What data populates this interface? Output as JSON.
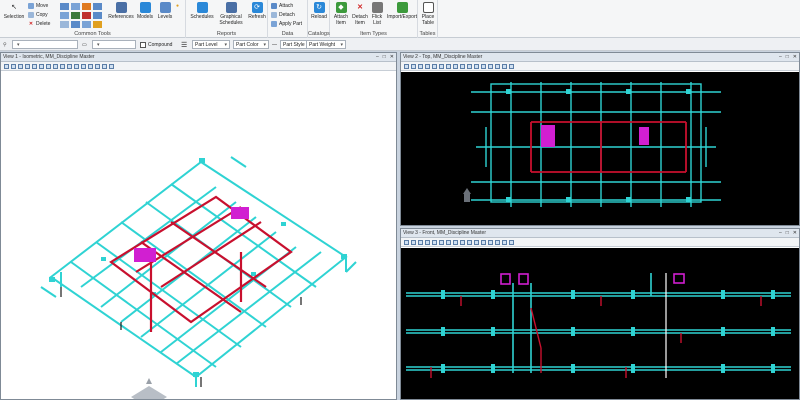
{
  "ribbon": {
    "common_tools": {
      "label": "Common Tools",
      "selection": "Selection",
      "move": "Move",
      "copy": "Copy",
      "delete": "Delete",
      "references": "References",
      "models": "Models",
      "levels": "Levels"
    },
    "reports": {
      "label": "Reports",
      "schedules": "Schedules",
      "graphical_schedules": "Graphical Schedules",
      "refresh": "Refresh"
    },
    "data": {
      "label": "Data",
      "attach": "Attach",
      "detach": "Detach",
      "apply_part": "Apply Part"
    },
    "catalogs": {
      "label": "Catalogs",
      "reload": "Reload"
    },
    "item_types": {
      "label": "Item Types",
      "attach_item": "Attach Item",
      "detach_item": "Detach Item",
      "flick_list": "Flick List",
      "import_export": "Import/Export"
    },
    "tables": {
      "label": "Tables",
      "place_table": "Place Table"
    }
  },
  "toolbar": {
    "compound": "Compound",
    "part_level": "Part Level",
    "part_color": "Part Color",
    "part_style": "Part Style",
    "part_weight": "Part Weight"
  },
  "views": {
    "view1": "View 1 - Isometric, MM_Discipline Master",
    "view2": "View 2 - Top, MM_Discipline Master",
    "view3": "View 3 - Front, MM_Discipline Master"
  },
  "colors": {
    "pipe_cyan": "#2fd3d3",
    "pipe_red": "#c8102e",
    "equipment_magenta": "#d11fd1",
    "view_black": "#000000"
  }
}
